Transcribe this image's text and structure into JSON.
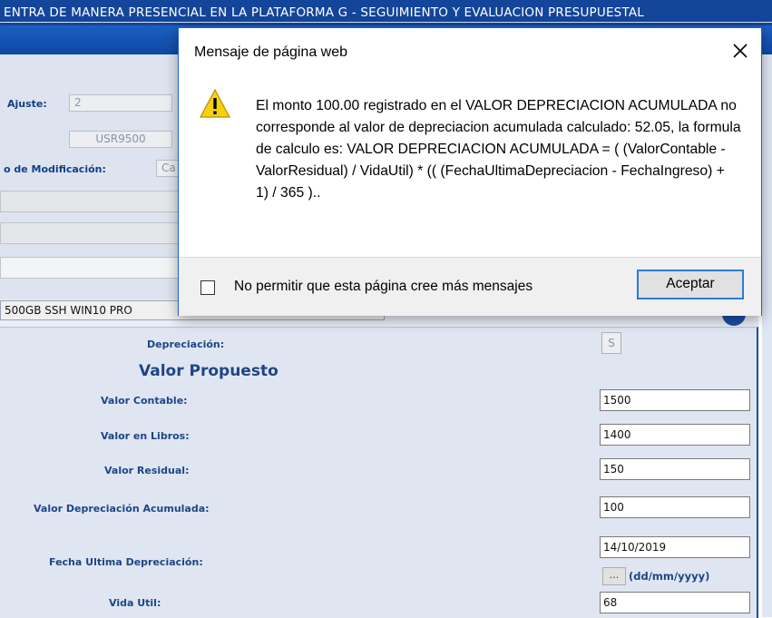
{
  "page": {
    "banner_text": "ENTRA DE MANERA PRESENCIAL EN LA PLATAFORMA G - SEGUIMIENTO Y EVALUACION PRESUPUESTAL",
    "labels": {
      "ajuste": "Ajuste:",
      "modificacion": "o de Modificación:"
    },
    "fields": {
      "ajuste_value": "2",
      "usuario_value": "USR9500",
      "modificacion_value": "Ca",
      "description_value": "500GB SSH WIN10 PRO"
    },
    "depreciacion_label": "Depreciación:",
    "depreciacion_value": "S",
    "section_title": "Valor Propuesto",
    "rows": [
      {
        "label": "Valor Contable:",
        "value": "1500"
      },
      {
        "label": "Valor en Libros:",
        "value": "1400"
      },
      {
        "label": "Valor Residual:",
        "value": "150"
      },
      {
        "label": "Valor Depreciación Acumulada:",
        "value": "100"
      },
      {
        "label": "Fecha Ultima Depreciación:",
        "value": "14/10/2019"
      },
      {
        "label": "Vida Util:",
        "value": "68"
      }
    ],
    "calendar_button": "...",
    "date_format_hint": "(dd/mm/yyyy)",
    "info_icon": "info-icon"
  },
  "dialog": {
    "title": "Mensaje de página web",
    "icon": "warning-icon",
    "message": " El monto 100.00 registrado en el VALOR DEPRECIACION ACUMULADA no corresponde al valor de depreciacion acumulada calculado: 52.05, la formula de calculo es: VALOR DEPRECIACION ACUMULADA = ( (ValorContable - ValorResidual) / VidaUtil) * (( (FechaUltimaDepreciacion - FechaIngreso) + 1) / 365 )..",
    "checkbox_label": "No permitir que esta página cree más mensajes",
    "checkbox_checked": false,
    "ok_label": "Aceptar",
    "close_icon": "close-icon"
  },
  "colors": {
    "banner": "#13459a",
    "panel": "#dfe6f1",
    "label_text": "#1e4586",
    "dialog_button_border": "#2f7ad6"
  }
}
